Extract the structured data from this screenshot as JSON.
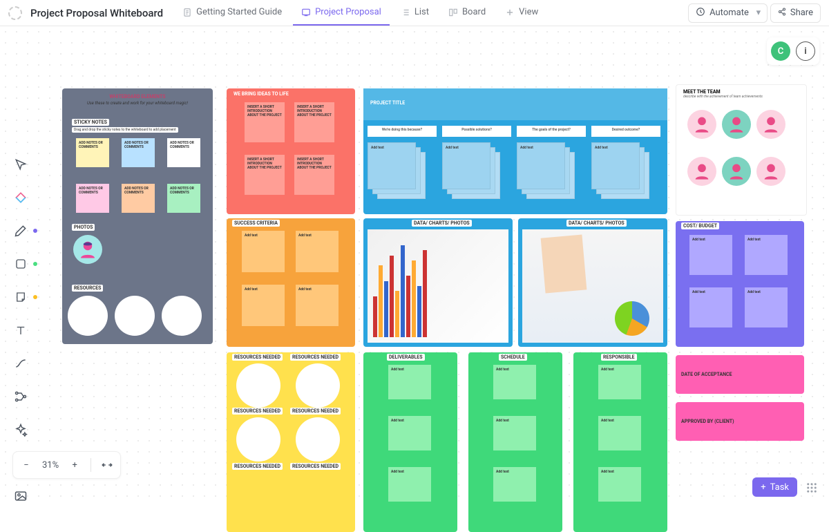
{
  "title": "Project Proposal Whiteboard",
  "tabs": {
    "guide": "Getting Started Guide",
    "proposal": "Project Proposal",
    "list": "List",
    "board": "Board",
    "view": "View"
  },
  "topbar": {
    "automate": "Automate",
    "share": "Share"
  },
  "user_initial": "C",
  "zoom": "31%",
  "task_button": "Task",
  "whiteboard": {
    "elements_title": "WHITEBOARD ELEMENTS",
    "elements_sub": "Use these to create and work for your whiteboard magic!",
    "sticky_label": "STICKY NOTES",
    "sticky_hint": "Drag and drop the sticky notes to the whiteboard to add placement",
    "note_text": "ADD NOTES OR COMMENTS",
    "photos_label": "PHOTOS",
    "resources_label": "RESOURCES"
  },
  "ideas": {
    "title": "WE BRING IDEAS TO LIFE",
    "note": "INSERT A SHORT INTRODUCTION ABOUT THE PROJECT"
  },
  "project": {
    "title": "PROJECT TITLE",
    "q1": "We're doing this because?",
    "q2": "Possible solutions?",
    "q3": "The goals of the project?",
    "q4": "Desired outcome?",
    "add": "Add text"
  },
  "team": {
    "title": "MEET THE TEAM",
    "sub": "describe with the achievement of team achievements"
  },
  "success": {
    "title": "SUCCESS CRITERIA",
    "add": "Add text"
  },
  "data": {
    "title": "DATA/ CHARTS/ PHOTOS"
  },
  "cost": {
    "title": "COST/ BUDGET",
    "add": "Add text"
  },
  "resources": {
    "title": "RESOURCES NEEDED"
  },
  "deliverables": {
    "title": "DELIVERABLES",
    "add": "Add text"
  },
  "schedule": {
    "title": "SCHEDULE",
    "add": "Add text"
  },
  "responsible": {
    "title": "RESPONSIBLE",
    "add": "Add text"
  },
  "acceptance": "DATE OF ACCEPTANCE",
  "approved": "APPROVED BY (CLIENT)"
}
